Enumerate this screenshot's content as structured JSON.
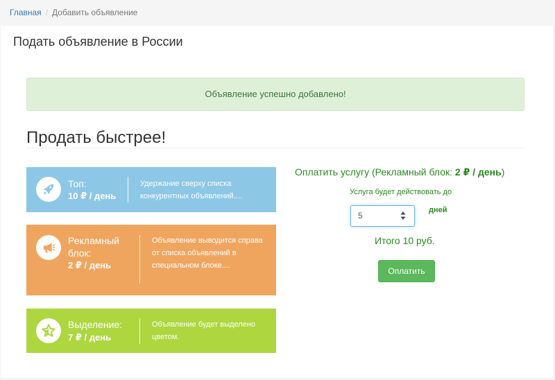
{
  "breadcrumb": {
    "home": "Главная",
    "current": "Добавить объявление"
  },
  "page": {
    "title": "Подать объявление в России"
  },
  "alert": {
    "text": "Объявление успешно добавлено!"
  },
  "sell": {
    "title": "Продать быстрее!"
  },
  "services": [
    {
      "icon": "rocket-icon",
      "name": "Топ:",
      "price": "10 ₽ / день",
      "description": "Удержание сверху списка конкурентных объявлений....",
      "color": "#8dc7e6"
    },
    {
      "icon": "megaphone-icon",
      "name": "Рекламный блок:",
      "price": "2 ₽ / день",
      "description": "Объявление выводится справа от списка объявлений в специальном блоке....",
      "color": "#f0a55f"
    },
    {
      "icon": "star-icon",
      "name": "Выделение:",
      "price": "7 ₽ / день",
      "description": "Объявление будет выделено цветом.",
      "color": "#add63f"
    }
  ],
  "payment": {
    "title_prefix": "Оплатить услугу (Рекламный блок: ",
    "title_price": "2 ₽ / день",
    "title_suffix": ")",
    "note": "Услуга будет действовать до",
    "days_value": "5",
    "days_label": "дней",
    "total": "Итого 10 руб.",
    "button": "Оплатить",
    "accent_color": "#2a8a1d",
    "button_color": "#5cb85c"
  }
}
